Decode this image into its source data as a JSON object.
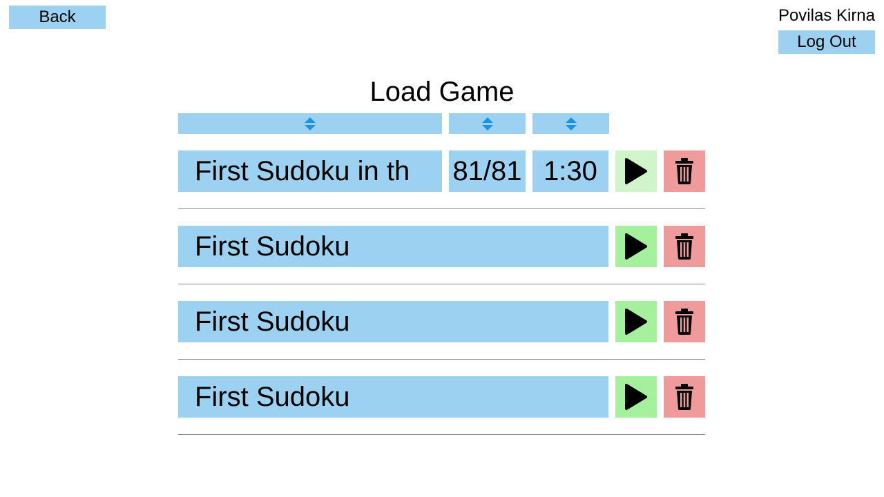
{
  "header": {
    "back_label": "Back",
    "user_name": "Povilas Kirna",
    "logout_label": "Log Out"
  },
  "title": "Load Game",
  "sort_columns": [
    {
      "icon": "sort-icon"
    },
    {
      "icon": "sort-icon"
    },
    {
      "icon": "sort-icon"
    }
  ],
  "colors": {
    "accent_blue": "#9dd1f1",
    "play_green": "#a5f09c",
    "delete_red": "#f09b9b",
    "sort_arrow": "#1a93e6"
  },
  "games": [
    {
      "name": "First Sudoku in th",
      "progress": "81/81",
      "time": "1:30",
      "play_icon": "play-icon",
      "delete_icon": "trash-icon"
    },
    {
      "name": "First Sudoku",
      "play_icon": "play-icon",
      "delete_icon": "trash-icon"
    },
    {
      "name": "First Sudoku",
      "play_icon": "play-icon",
      "delete_icon": "trash-icon"
    },
    {
      "name": "First Sudoku",
      "play_icon": "play-icon",
      "delete_icon": "trash-icon"
    }
  ]
}
